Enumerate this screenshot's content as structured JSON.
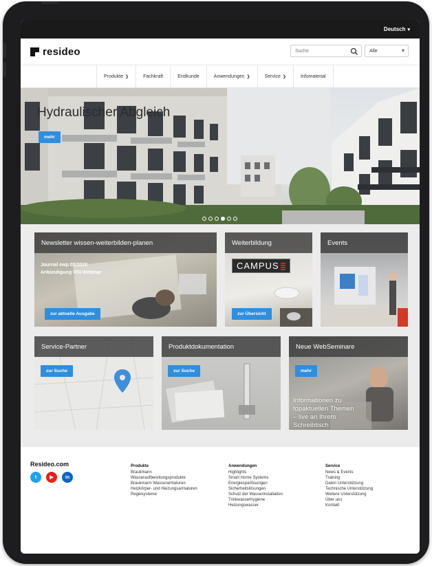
{
  "topbar": {
    "language": "Deutsch"
  },
  "header": {
    "logo_text": "resideo",
    "search_placeholder": "Suche",
    "select_value": "Alle"
  },
  "nav": {
    "items": [
      {
        "label": "Produkte",
        "has_dropdown": true
      },
      {
        "label": "Fachkraft",
        "has_dropdown": false
      },
      {
        "label": "Endkunde",
        "has_dropdown": false
      },
      {
        "label": "Anwendungen",
        "has_dropdown": true
      },
      {
        "label": "Service",
        "has_dropdown": true
      },
      {
        "label": "Infomaterial",
        "has_dropdown": false
      }
    ]
  },
  "hero": {
    "title": "Hydraulischer Abgleich",
    "button": "mehr",
    "slide_count": 6,
    "active_slide": 4
  },
  "tiles": {
    "newsletter": {
      "title": "Newsletter wissen-weiterbilden-planen",
      "line1": "Journal ewp 05/2020",
      "line2": "Ankündigung VDI-Webinar",
      "button": "zur aktuelle Ausgabe"
    },
    "weiterbildung": {
      "title": "Weiterbildung",
      "campus": "CAMPUS",
      "button": "zur Übersicht"
    },
    "events": {
      "title": "Events"
    },
    "service_partner": {
      "title": "Service-Partner",
      "button": "zur Suche"
    },
    "produktdokumentation": {
      "title": "Produktdokumentation",
      "button": "zur Suche"
    },
    "webseminare": {
      "title": "Neue WebSeminare",
      "button": "mehr",
      "text": "Informationen zu topaktuellen Themen – live an Ihrem Schreibtisch"
    }
  },
  "footer": {
    "brand": "Resideo.com",
    "social": [
      {
        "icon": "twitter-icon",
        "color": "#1da1f2",
        "glyph": "t"
      },
      {
        "icon": "youtube-icon",
        "color": "#e62117",
        "glyph": "▶"
      },
      {
        "icon": "linkedin-icon",
        "color": "#0a66c2",
        "glyph": "in"
      }
    ],
    "columns": [
      {
        "heading": "Produkte",
        "items": [
          "Braukmann",
          "Wasseraufbereitungsprodukte",
          "Braukmann Wasserarmaturen",
          "Heizkörper- und Heizungsarmaturen",
          "Regelsysteme"
        ]
      },
      {
        "heading": "Anwendungen",
        "items": [
          "Highlights",
          "Smart Home Systems",
          "Energiesparlösungen",
          "Sicherheitslösungen",
          "Schutz der Wasserinstallation",
          "Trinkwasserhygiene",
          "Heizungswasser"
        ]
      },
      {
        "heading": "Service",
        "items": [
          "News & Events",
          "Training",
          "Daten Unterstützung",
          "Technische Unterstützung",
          "Weitere Unterstützung",
          "Über uns",
          "Kontakt"
        ]
      }
    ]
  },
  "colors": {
    "accent": "#2f8ede",
    "topbar": "#1a1a1a",
    "tile_bar": "#3c3c3c"
  }
}
